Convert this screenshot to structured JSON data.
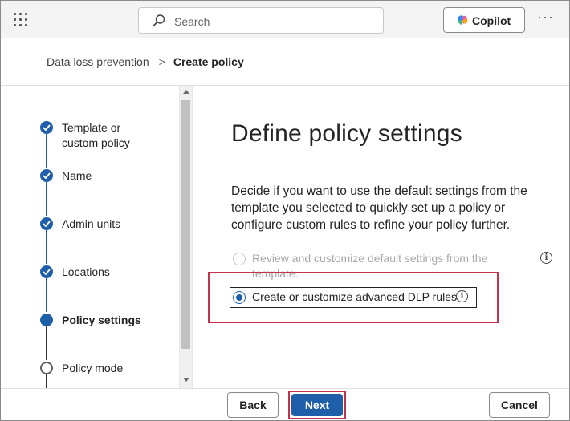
{
  "topbar": {
    "search_placeholder": "Search",
    "copilot_label": "Copilot",
    "more_label": "···"
  },
  "breadcrumb": {
    "parent": "Data loss prevention",
    "separator": ">",
    "current": "Create policy"
  },
  "steps": [
    {
      "label": "Template or custom policy",
      "state": "done"
    },
    {
      "label": "Name",
      "state": "done"
    },
    {
      "label": "Admin units",
      "state": "done"
    },
    {
      "label": "Locations",
      "state": "done"
    },
    {
      "label": "Policy settings",
      "state": "current"
    },
    {
      "label": "Policy mode",
      "state": "todo"
    }
  ],
  "main": {
    "title": "Define policy settings",
    "description": "Decide if you want to use the default settings from the template you selected to quickly set up a policy or configure custom rules to refine your policy further.",
    "options": [
      {
        "label": "Review and customize default settings from the template.",
        "selected": false,
        "disabled": true
      },
      {
        "label": "Create or customize advanced DLP rules",
        "selected": true,
        "disabled": false
      }
    ],
    "info_glyph": "i"
  },
  "footer": {
    "back_label": "Back",
    "next_label": "Next",
    "cancel_label": "Cancel"
  },
  "colors": {
    "accent": "#1f5fa9",
    "highlight_outline": "#c4314b"
  }
}
